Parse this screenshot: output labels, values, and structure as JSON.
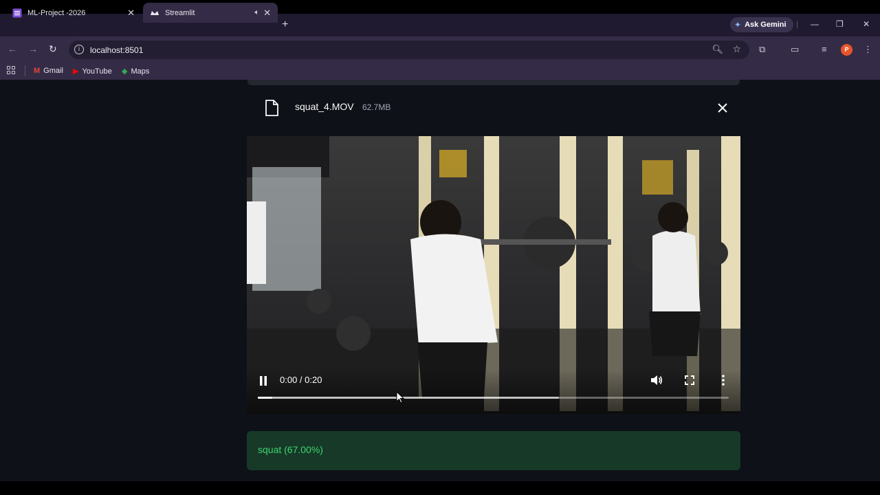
{
  "browser": {
    "tabs": [
      {
        "title": "ML-Project -2026",
        "active": false
      },
      {
        "title": "Streamlit",
        "active": true,
        "audio": true
      }
    ],
    "ask_gemini_label": "Ask Gemini",
    "url": "localhost:8501",
    "profile_initial": "P",
    "bookmarks": [
      {
        "label": "Gmail",
        "icon": "gmail-icon"
      },
      {
        "label": "YouTube",
        "icon": "youtube-icon"
      },
      {
        "label": "Maps",
        "icon": "maps-icon"
      }
    ],
    "colors": {
      "tabstrip": "#201a30",
      "toolbar": "#342c46"
    }
  },
  "uploader": {
    "file_name": "squat_4.MOV",
    "file_size": "62.7MB"
  },
  "video": {
    "time_label": "0:00 / 0:20",
    "played_fraction": 0.03,
    "buffered_fraction": 0.64,
    "state": "playing"
  },
  "result": {
    "text": "squat (67.00%)",
    "colors": {
      "background": "#173928",
      "text": "#3dd56d"
    }
  }
}
